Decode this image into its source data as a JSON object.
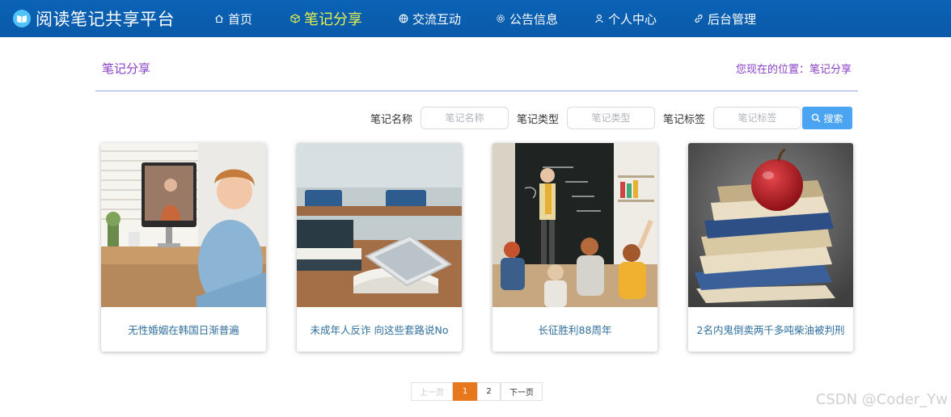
{
  "brand": {
    "title": "阅读笔记共享平台"
  },
  "nav": {
    "items": [
      {
        "label": "首页",
        "icon": "home-icon"
      },
      {
        "label": "笔记分享",
        "icon": "cube-icon"
      },
      {
        "label": "交流互动",
        "icon": "globe-icon"
      },
      {
        "label": "公告信息",
        "icon": "gear-icon"
      },
      {
        "label": "个人中心",
        "icon": "user-icon"
      },
      {
        "label": "后台管理",
        "icon": "link-icon"
      }
    ],
    "active_index": 1
  },
  "page": {
    "title": "笔记分享",
    "breadcrumb": "您现在的位置：笔记分享"
  },
  "search": {
    "name_label": "笔记名称",
    "name_placeholder": "笔记名称",
    "type_label": "笔记类型",
    "type_placeholder": "笔记类型",
    "tag_label": "笔记标签",
    "tag_placeholder": "笔记标签",
    "button_label": "搜索"
  },
  "cards": [
    {
      "title": "无性婚姻在韩国日渐普遍"
    },
    {
      "title": "未成年人反诈 向这些套路说No"
    },
    {
      "title": "长征胜利88周年"
    },
    {
      "title": "2名内鬼倒卖两千多吨柴油被判刑"
    }
  ],
  "pagination": {
    "prev": "上一页",
    "pages": [
      "1",
      "2"
    ],
    "current": "1",
    "next": "下一页"
  },
  "watermark": "CSDN @Coder_Yw",
  "colors": {
    "nav_bg": "#0b63b6",
    "nav_active": "#e6f24b",
    "title_purple": "#8a3fc8",
    "search_btn": "#4aa4f2",
    "page_current": "#e8781d"
  }
}
